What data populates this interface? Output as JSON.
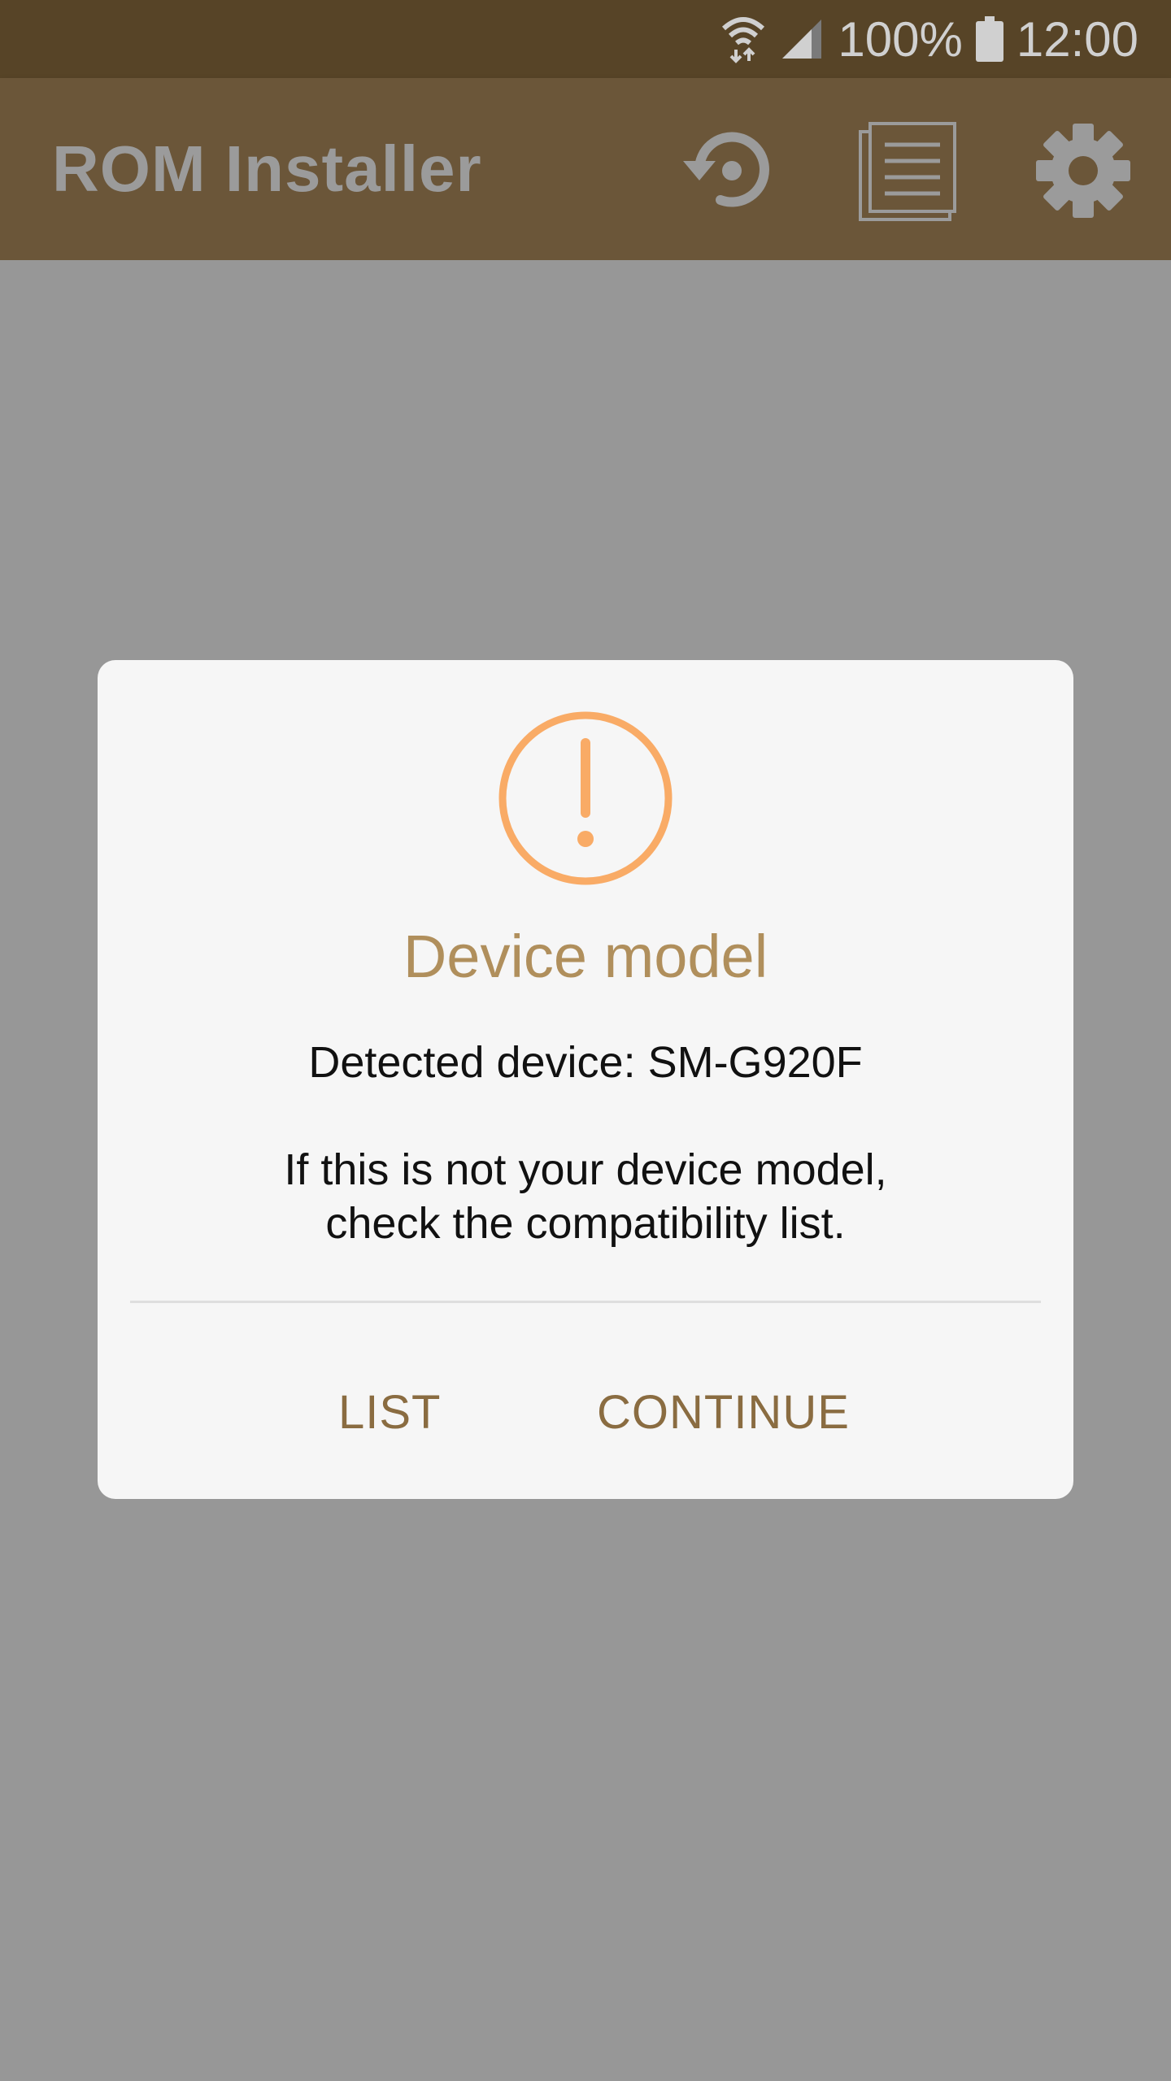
{
  "status_bar": {
    "battery": "100%",
    "time": "12:00"
  },
  "app_bar": {
    "title": "ROM Installer",
    "icons": [
      "restore-icon",
      "log-list-icon",
      "settings-gear-icon"
    ]
  },
  "dialog": {
    "icon": "warning-circle-icon",
    "title": "Device model",
    "detected": "Detected device: SM-G920F",
    "message_line1": "If this is not your device model,",
    "message_line2": "check the compatibility list.",
    "button_list": "LIST",
    "button_continue": "CONTINUE"
  },
  "colors": {
    "status_bar": "#574427",
    "app_bar": "#6b5639",
    "scrim": "#979797",
    "dialog_bg": "#f6f6f6",
    "accent_title": "#b08f5c",
    "accent_button": "#8a6c41",
    "warning_icon": "#f9ab66"
  }
}
